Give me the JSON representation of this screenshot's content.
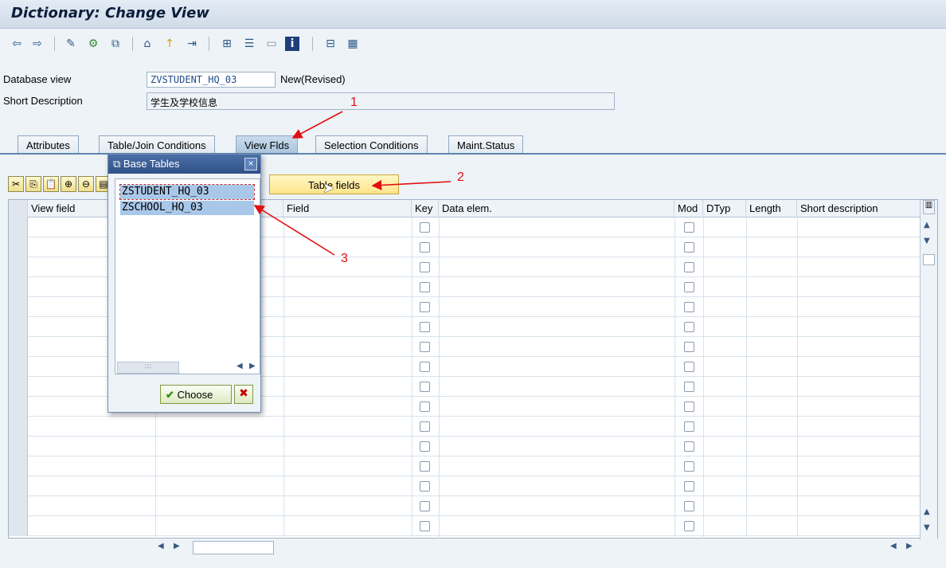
{
  "window": {
    "title": "Dictionary: Change View"
  },
  "toolbar": {
    "icons": [
      "back-icon",
      "forward-icon",
      "edit-icon",
      "display-change-icon",
      "other-object-icon",
      "where-used-icon",
      "activate-icon",
      "navigate-icon",
      "hierarchy-icon",
      "tree-icon",
      "table-icon",
      "info-icon",
      "technical-settings-icon",
      "layout-icon"
    ]
  },
  "header": {
    "db_view_label": "Database view",
    "db_view_value": "ZVSTUDENT_HQ_03",
    "db_view_status": "New(Revised)",
    "short_desc_label": "Short Description",
    "short_desc_value": "学生及学校信息"
  },
  "tabs": [
    {
      "label": "Attributes"
    },
    {
      "label": "Table/Join Conditions"
    },
    {
      "label": "View Flds",
      "active": true
    },
    {
      "label": "Selection Conditions"
    },
    {
      "label": "Maint.Status"
    }
  ],
  "table_fields_button": "Table fields",
  "grid": {
    "columns": [
      "View field",
      "",
      "Field",
      "Key",
      "Data elem.",
      "Mod",
      "DTyp",
      "Length",
      "Short description"
    ],
    "row_count": 16
  },
  "popup": {
    "title": "Base Tables",
    "items": [
      "ZSTUDENT_HQ_03",
      "ZSCHOOL_HQ_03"
    ],
    "choose_label": "Choose",
    "close_glyph": "×",
    "cancel_glyph": "✖"
  },
  "annotations": {
    "a1": "1",
    "a2": "2",
    "a3": "3"
  },
  "colors": {
    "annotation": "#e01010",
    "accent": "#2f5089",
    "highlight": "#a9c7e8"
  }
}
